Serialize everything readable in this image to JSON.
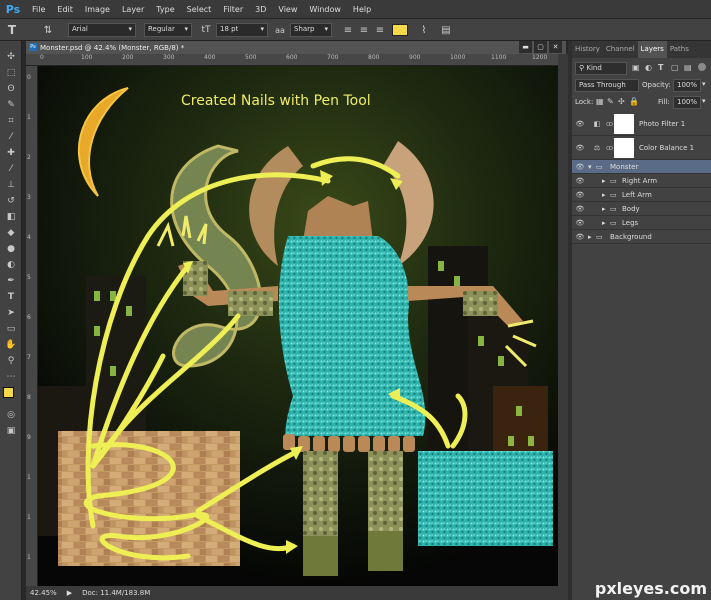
{
  "app": {
    "logo": "Ps"
  },
  "menu": [
    "File",
    "Edit",
    "Image",
    "Layer",
    "Type",
    "Select",
    "Filter",
    "3D",
    "View",
    "Window",
    "Help"
  ],
  "options": {
    "tool_glyph": "T",
    "font_family": "Arial",
    "font_style": "Regular",
    "font_size": "18 pt",
    "antialias": "Sharp",
    "text_color": "#f5d94a"
  },
  "document": {
    "title": "Monster.psd @ 42.4% (Monster, RGB/8) *",
    "win_min": "▬",
    "win_max": "▢",
    "win_close": "✕",
    "ruler_top": [
      "0",
      "100",
      "200",
      "300",
      "400",
      "500",
      "600",
      "700",
      "800",
      "900",
      "1000",
      "1100",
      "1200"
    ],
    "ruler_left": [
      "0",
      "1",
      "2",
      "3",
      "4",
      "5",
      "6",
      "7",
      "8",
      "9",
      "1",
      "1",
      "1"
    ]
  },
  "canvas": {
    "caption": "Created Nails with Pen Tool",
    "caption_color": "#f0eb6a"
  },
  "status": {
    "zoom": "42.45%",
    "doc": "Doc: 11.4M/183.8M"
  },
  "panels": {
    "tabs": [
      "History",
      "Channel",
      "Layers",
      "Paths"
    ],
    "active_tab": "Layers",
    "filter_kind": "Kind",
    "blend_mode": "Pass Through",
    "opacity_label": "Opacity:",
    "opacity_value": "100%",
    "lock_label": "Lock:",
    "fill_label": "Fill:",
    "fill_value": "100%",
    "layers": [
      {
        "name": "Photo Filter 1",
        "selected": false,
        "indent": 0,
        "type": "adjustment"
      },
      {
        "name": "Color Balance 1",
        "selected": false,
        "indent": 0,
        "type": "adjustment"
      },
      {
        "name": "Monster",
        "selected": true,
        "indent": 0,
        "type": "group-open"
      },
      {
        "name": "Right Arm",
        "selected": false,
        "indent": 1,
        "type": "group"
      },
      {
        "name": "Left Arm",
        "selected": false,
        "indent": 1,
        "type": "group"
      },
      {
        "name": "Body",
        "selected": false,
        "indent": 1,
        "type": "group"
      },
      {
        "name": "Legs",
        "selected": false,
        "indent": 1,
        "type": "group"
      },
      {
        "name": "Background",
        "selected": false,
        "indent": 0,
        "type": "group"
      }
    ]
  },
  "watermark": "pxleyes.com"
}
